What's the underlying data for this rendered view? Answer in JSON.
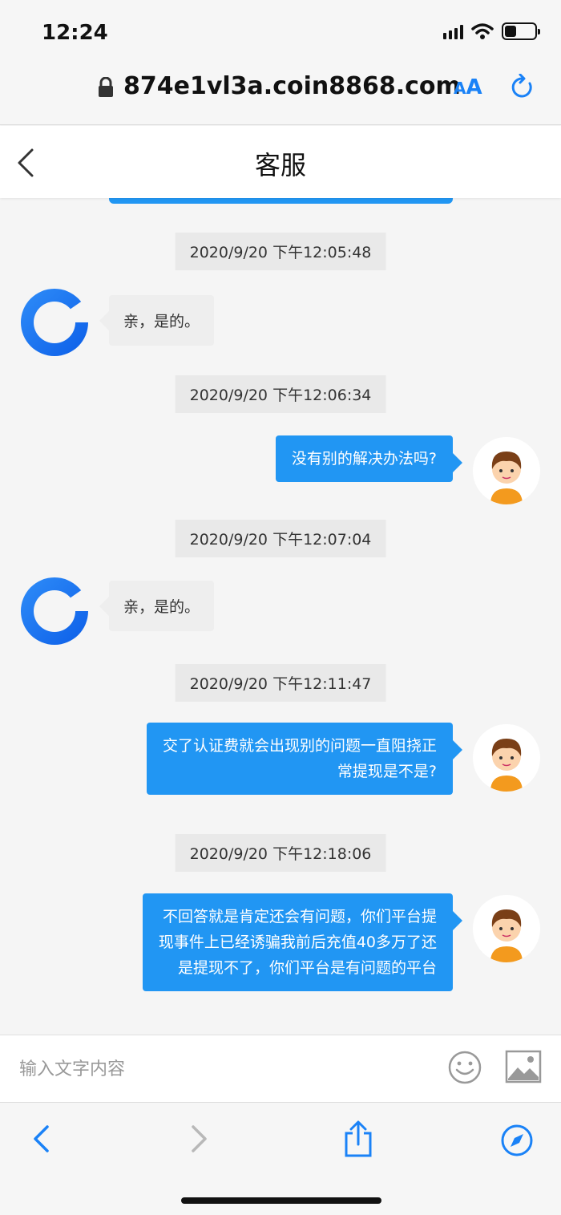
{
  "status_bar": {
    "time": "12:24",
    "battery_level": 0.4
  },
  "browser": {
    "url": "874e1vl3a.coin8868.com",
    "text_size_label": "AA"
  },
  "header": {
    "title": "客服"
  },
  "messages": [
    {
      "timestamp": "2020/9/20 下午12:05:48",
      "sender": "agent",
      "lines": [
        "亲，是的。"
      ]
    },
    {
      "timestamp": "2020/9/20 下午12:06:34",
      "sender": "user",
      "lines": [
        "没有别的解决办法吗?"
      ]
    },
    {
      "timestamp": "2020/9/20 下午12:07:04",
      "sender": "agent",
      "lines": [
        "亲，是的。"
      ]
    },
    {
      "timestamp": "2020/9/20 下午12:11:47",
      "sender": "user",
      "lines": [
        "交了认证费就会出现别的问题一直阻挠正",
        "常提现是不是?"
      ]
    },
    {
      "timestamp": "2020/9/20 下午12:18:06",
      "sender": "user",
      "lines": [
        "不回答就是肯定还会有问题，你们平台提",
        "现事件上已经诱骗我前后充值40多万了还",
        "是提现不了，你们平台是有问题的平台"
      ]
    }
  ],
  "composer": {
    "placeholder": "输入文字内容",
    "value": ""
  },
  "colors": {
    "accent": "#2196f3",
    "safari_blue": "#1a82f7"
  }
}
